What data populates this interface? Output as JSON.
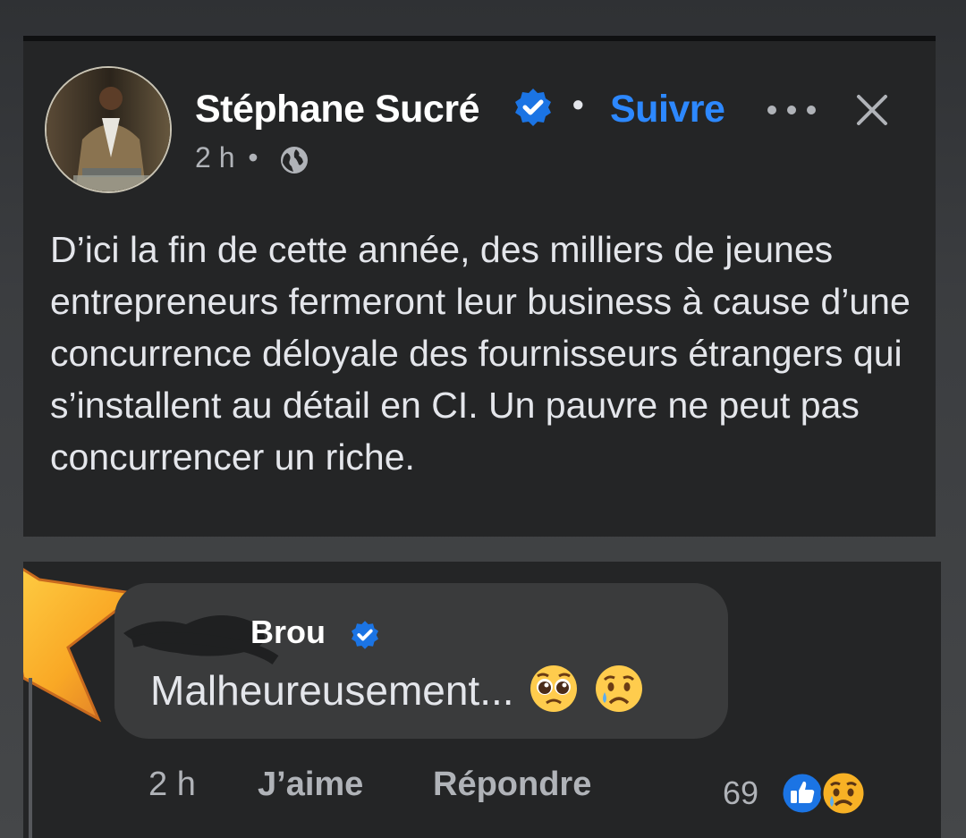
{
  "post": {
    "author": "Stéphane Sucré",
    "follow_label": "Suivre",
    "separator": "•",
    "time": "2 h",
    "meta_separator": "•",
    "text": "D’ici la fin de cette année, des milliers de jeunes entrepreneurs fermeront leur business à cause d’une concurrence déloyale des fournisseurs étrangers qui s’installent au détail en CI. Un pauvre ne peut pas concurrencer un riche."
  },
  "comment": {
    "author": "Brou",
    "text": "Malheureusement...",
    "time": "2 h",
    "like_label": "J’aime",
    "reply_label": "Répondre",
    "reaction_count": "69"
  },
  "icons": {
    "verified": "verified-badge-icon",
    "more": "more-options-icon",
    "close": "close-icon",
    "globe": "globe-icon",
    "star": "star-icon",
    "pleading": "pleading-face-emoji",
    "sad": "sad-tear-face-emoji",
    "like_reaction": "like-reaction-icon",
    "sad_reaction": "sad-reaction-icon"
  },
  "colors": {
    "card_bg": "#242526",
    "accent_blue": "#2d88ff",
    "bubble_bg": "#3a3b3c",
    "text": "#e4e6eb",
    "secondary_text": "#b0b3b8"
  }
}
